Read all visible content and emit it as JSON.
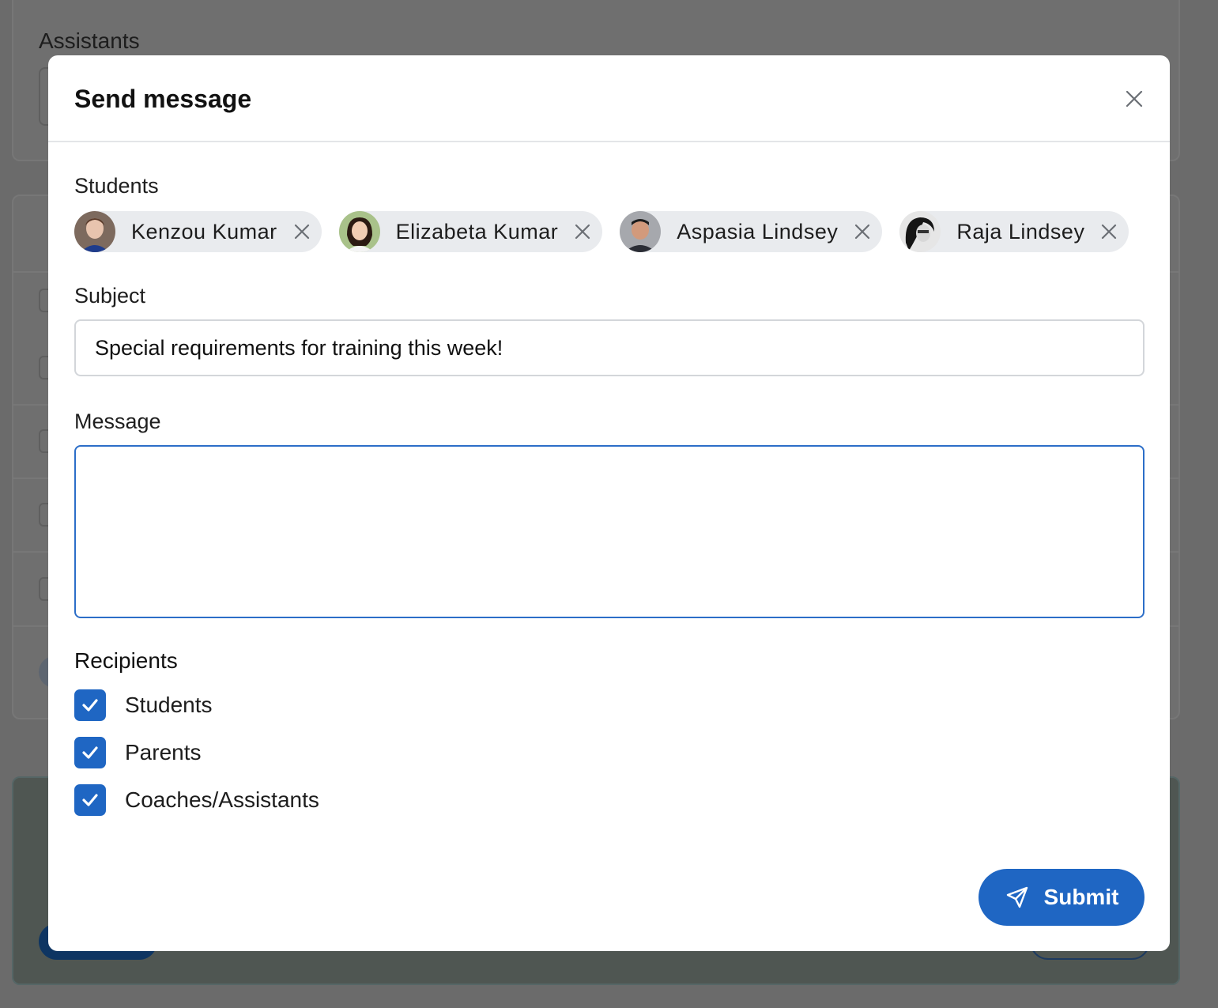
{
  "background": {
    "assistants_label": "Assistants"
  },
  "modal": {
    "title": "Send message",
    "students_label": "Students",
    "students": [
      {
        "name": "Kenzou Kumar"
      },
      {
        "name": "Elizabeta Kumar"
      },
      {
        "name": "Aspasia Lindsey"
      },
      {
        "name": "Raja Lindsey"
      }
    ],
    "subject_label": "Subject",
    "subject_value": "Special requirements for training this week!",
    "message_label": "Message",
    "message_value": "",
    "recipients_label": "Recipients",
    "recipients": [
      {
        "label": "Students",
        "checked": true
      },
      {
        "label": "Parents",
        "checked": true
      },
      {
        "label": "Coaches/Assistants",
        "checked": true
      }
    ],
    "submit_label": "Submit"
  },
  "colors": {
    "primary": "#1f66c3",
    "overlay": "#6b6b6b",
    "chip_bg": "#e9ebee"
  },
  "icons": [
    "close-icon",
    "remove-chip-icon",
    "checkmark-icon",
    "send-icon"
  ]
}
